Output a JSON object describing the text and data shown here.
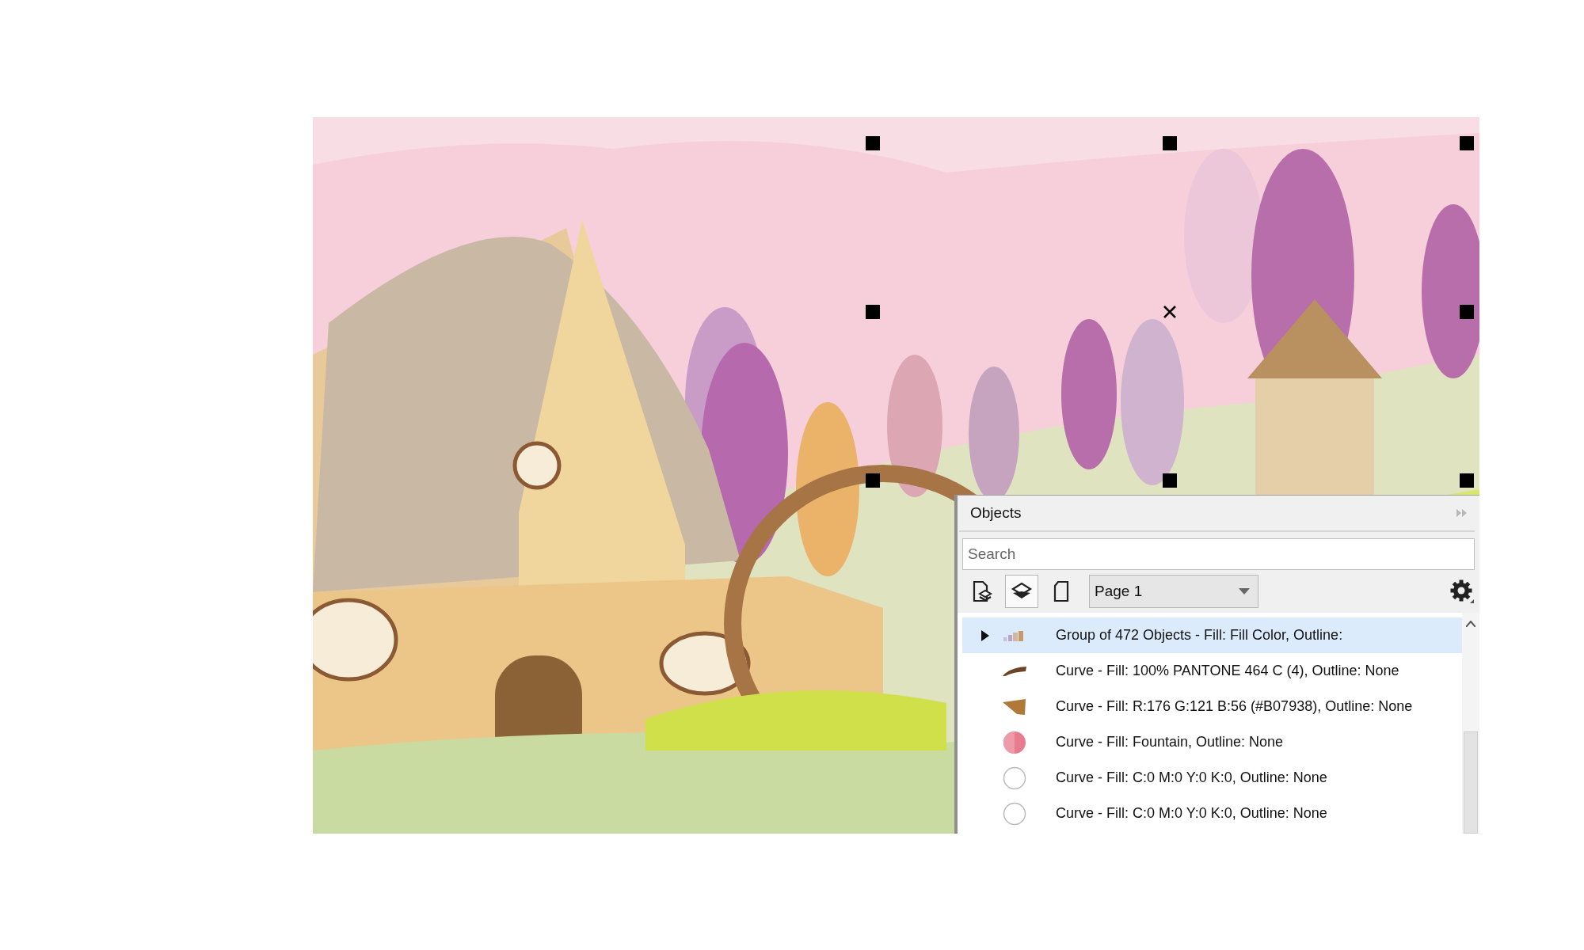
{
  "panel": {
    "title": "Objects",
    "search": {
      "placeholder": "Search"
    },
    "tool_buttons": [
      {
        "kind": "page-layers",
        "pressed": false
      },
      {
        "kind": "layers",
        "pressed": true
      },
      {
        "kind": "page",
        "pressed": false
      }
    ],
    "page_select": {
      "value": "Page 1"
    },
    "items": [
      {
        "label": "Group of 472 Objects - Fill: Fill Color, Outline:",
        "kind": "group",
        "expandable": true,
        "selected": true
      },
      {
        "label": "Curve - Fill: 100% PANTONE 464 C (4), Outline: None",
        "kind": "stroke",
        "expandable": false,
        "selected": false
      },
      {
        "label": "Curve - Fill: R:176 G:121 B:56 (#B07938), Outline: None",
        "kind": "wedge",
        "expandable": false,
        "selected": false
      },
      {
        "label": "Curve - Fill: Fountain, Outline: None",
        "kind": "pink-circle",
        "expandable": false,
        "selected": false
      },
      {
        "label": "Curve - Fill: C:0 M:0 Y:0 K:0, Outline: None",
        "kind": "empty-circle",
        "expandable": false,
        "selected": false
      },
      {
        "label": "Curve - Fill: C:0 M:0 Y:0 K:0, Outline: None",
        "kind": "empty-circle",
        "expandable": false,
        "selected": false
      }
    ]
  }
}
